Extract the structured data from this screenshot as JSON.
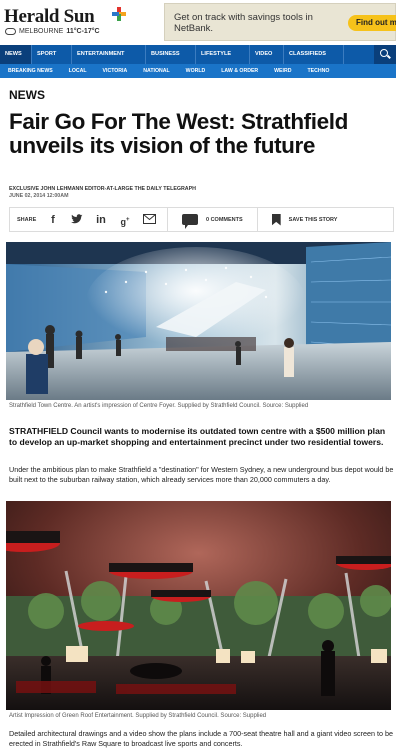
{
  "header": {
    "logo": "Herald Sun",
    "weather_city": "MELBOURNE",
    "weather_temp": "11°C-17°C",
    "ad_text": "Get on track with savings tools in NetBank.",
    "ad_button": "Find out m"
  },
  "nav": {
    "items": [
      "NEWS",
      "SPORT",
      "ENTERTAINMENT",
      "BUSINESS",
      "LIFESTYLE",
      "VIDEO",
      "CLASSIFIEDS"
    ],
    "sub_items": [
      "BREAKING NEWS",
      "LOCAL",
      "VICTORIA",
      "NATIONAL",
      "WORLD",
      "LAW & ORDER",
      "WEIRD",
      "TECHNO"
    ]
  },
  "article": {
    "section": "NEWS",
    "headline": "Fair Go For The West: Strathfield unveils its vision of the future",
    "byline": "EXCLUSIVE JOHN LEHMANN EDITOR-AT-LARGE  THE DAILY TELEGRAPH",
    "date": "JUNE 02, 2014 12:00AM",
    "share_label": "SHARE",
    "comments_label": "0 COMMENTS",
    "save_label": "SAVE THIS STORY",
    "caption1": "Strathfield Town Centre. An artist's impression of Centre Foyer. Supplied by Strathfield Council. Source: Supplied",
    "lead": "STRATHFIELD Council wants to modernise its outdated town centre with a $500 million plan to develop an up-market shopping and entertainment precinct under two residential towers.",
    "body1": "Under the ambitious plan to make Strathfield a \"destination\" for Western Sydney, a new underground bus depot would be built next to the suburban railway station, which already services more than 20,000 commuters a day.",
    "caption2": "Artist Impression of Green Roof Entertainment. Supplied by Strathfield Council. Source: Supplied",
    "body2": "Detailed architectural drawings and a video show the plans include a 700-seat theatre hall and a giant video screen to be erected in Strathfield's Raw Square to broadcast live sports and concerts."
  },
  "colors": {
    "nav_bg": "#0d5aa8",
    "subnav_bg": "#1a74c8",
    "ad_button": "#f6c21a"
  }
}
